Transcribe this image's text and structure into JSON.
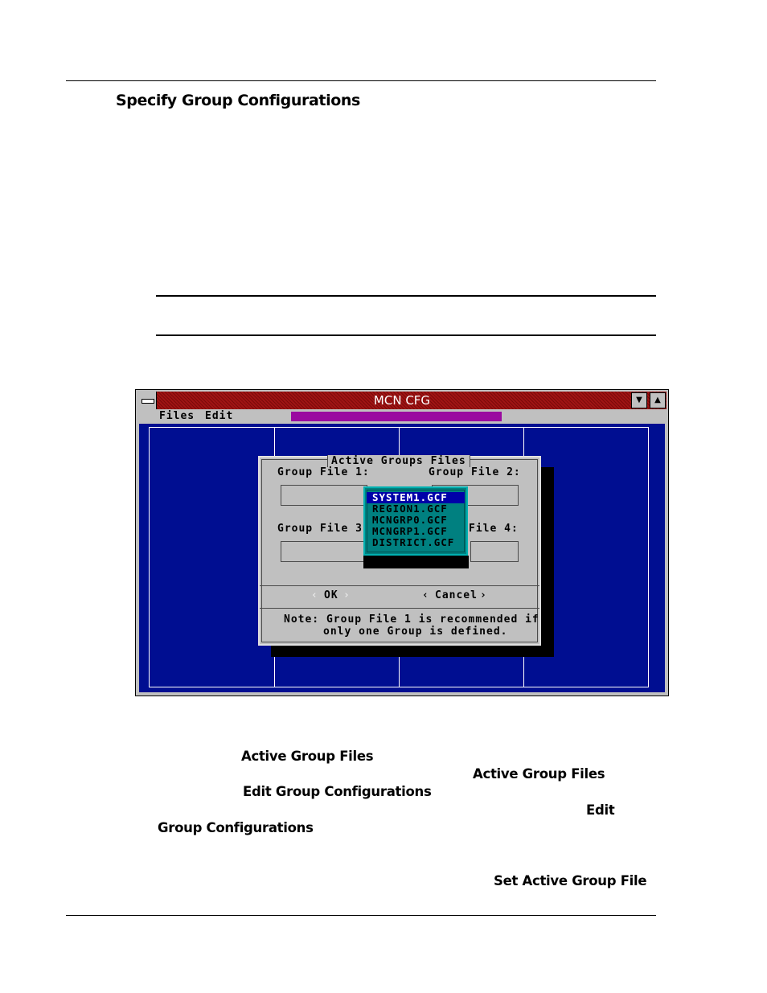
{
  "heading": "Specify Group Configurations",
  "window": {
    "title": "MCN CFG",
    "menu": [
      "Files",
      "Edit"
    ],
    "scroll_down_glyph": "▼",
    "scroll_up_glyph": "▲"
  },
  "dialog": {
    "title": "Active Groups Files",
    "field1_label": "Group File 1:",
    "field2_label": "Group File 2:",
    "field3_label": "Group File 3:",
    "field4_label": "File 4:",
    "ok_label": "OK",
    "cancel_label": "Cancel",
    "left_arrow": "‹",
    "right_arrow": "›",
    "note_line1": "Note: Group File 1 is recommended if",
    "note_line2": "only one Group is defined.",
    "list_items": [
      "SYSTEM1.GCF",
      "REGION1.GCF",
      "MCNGRP0.GCF",
      "MCNGRP1.GCF",
      "DISTRICT.GCF"
    ],
    "selected_index": 0
  },
  "refs": {
    "ref1": "Active Group Files",
    "ref2": "Active Group Files",
    "ref3": "Edit Group Configurations",
    "ref4": "Edit",
    "ref5": "Group Configurations",
    "ref6": "Set Active Group File"
  }
}
